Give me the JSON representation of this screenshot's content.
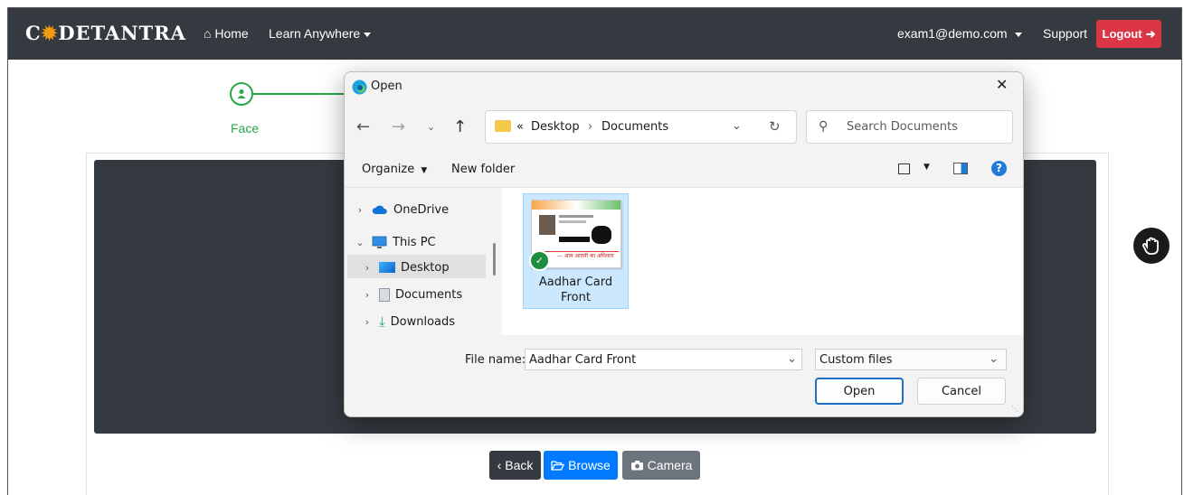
{
  "navbar": {
    "brand_left": "C",
    "brand_right": "DETANTRA",
    "home": "Home",
    "learn": "Learn Anywhere",
    "user": "exam1@demo.com",
    "support": "Support",
    "logout": "Logout"
  },
  "steps": [
    {
      "label": "Face"
    }
  ],
  "buttons": {
    "back": "Back",
    "browse": "Browse",
    "camera": "Camera"
  },
  "colors": {
    "navbar": "#343a40",
    "success": "#28a745",
    "danger": "#dc3545",
    "primary": "#007bff",
    "secondary": "#6c757d"
  },
  "dialog": {
    "title": "Open",
    "breadcrumb": [
      "Desktop",
      "Documents"
    ],
    "search_placeholder": "Search Documents",
    "organize": "Organize",
    "new_folder": "New folder",
    "nav_items": [
      {
        "label": "OneDrive",
        "icon": "cloud-icon"
      },
      {
        "label": "This PC",
        "icon": "computer-icon"
      },
      {
        "label": "Desktop",
        "icon": "desktop-folder-icon"
      },
      {
        "label": "Documents",
        "icon": "documents-icon"
      },
      {
        "label": "Downloads",
        "icon": "download-icon"
      }
    ],
    "file": {
      "name_line1": "Aadhar Card",
      "name_line2": "Front",
      "card_text": "— आम आदमी का अधिकार"
    },
    "file_name_label": "File name:",
    "file_name_value": "Aadhar Card Front",
    "file_type": "Custom files",
    "open_button": "Open",
    "cancel_button": "Cancel"
  }
}
